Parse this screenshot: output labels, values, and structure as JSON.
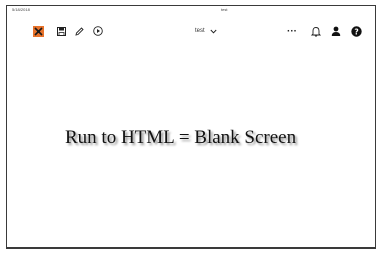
{
  "header": {
    "date": "5/18/2018",
    "title": "test"
  },
  "toolbar": {
    "icons": [
      "tools-icon",
      "save-icon",
      "pencil-icon",
      "play-icon",
      "more-icon",
      "bell-icon",
      "user-icon",
      "help-icon"
    ],
    "accent": "#e8722a",
    "document_name": "test",
    "more_label": "···"
  },
  "main": {
    "caption": "Run to HTML = Blank Screen"
  }
}
